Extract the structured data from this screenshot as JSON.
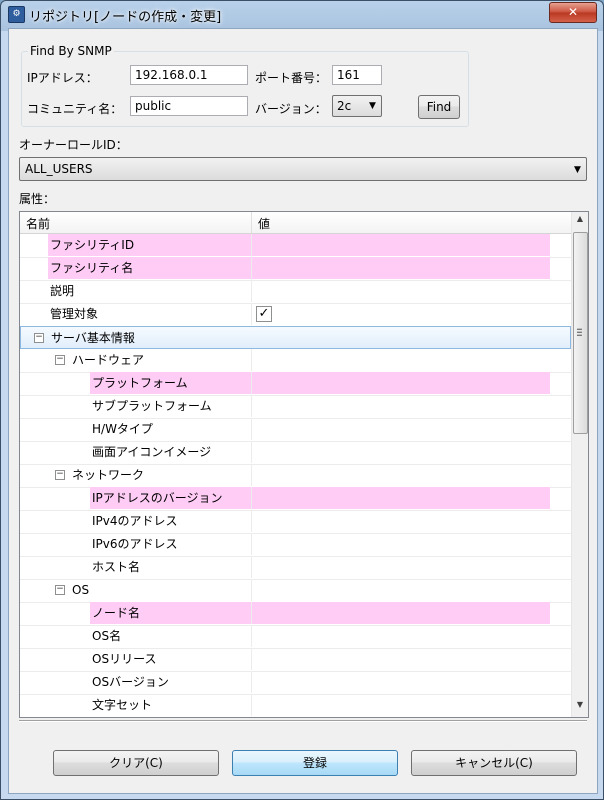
{
  "window": {
    "title": "リポジトリ[ノードの作成・変更]",
    "close_label": "✕"
  },
  "snmp": {
    "group_title": "Find By SNMP",
    "ip_label": "IPアドレス：",
    "ip_value": "192.168.0.1",
    "port_label": "ポート番号：",
    "port_value": "161",
    "community_label": "コミュニティ名：",
    "community_value": "public",
    "version_label": "バージョン：",
    "version_value": "2c",
    "find_label": "Find"
  },
  "owner": {
    "label": "オーナーロールID：",
    "value": "ALL_USERS"
  },
  "attributes": {
    "label": "属性：",
    "col_name": "名前",
    "col_value": "値",
    "rows": [
      {
        "name": "ファシリティID",
        "indent": 0,
        "required": true
      },
      {
        "name": "ファシリティ名",
        "indent": 0,
        "required": true
      },
      {
        "name": "説明",
        "indent": 0,
        "required": false
      },
      {
        "name": "管理対象",
        "indent": 0,
        "required": false,
        "checked": true
      },
      {
        "name": "サーバ基本情報",
        "indent": 0,
        "group": true,
        "expanded": true,
        "selected": true
      },
      {
        "name": "ハードウェア",
        "indent": 1,
        "group": true,
        "expanded": true
      },
      {
        "name": "プラットフォーム",
        "indent": 2,
        "required": true
      },
      {
        "name": "サブプラットフォーム",
        "indent": 2,
        "required": false
      },
      {
        "name": "H/Wタイプ",
        "indent": 2,
        "required": false
      },
      {
        "name": "画面アイコンイメージ",
        "indent": 2,
        "required": false
      },
      {
        "name": "ネットワーク",
        "indent": 1,
        "group": true,
        "expanded": true
      },
      {
        "name": "IPアドレスのバージョン",
        "indent": 2,
        "required": true
      },
      {
        "name": "IPv4のアドレス",
        "indent": 2,
        "required": false
      },
      {
        "name": "IPv6のアドレス",
        "indent": 2,
        "required": false
      },
      {
        "name": "ホスト名",
        "indent": 2,
        "required": false
      },
      {
        "name": "OS",
        "indent": 1,
        "group": true,
        "expanded": true
      },
      {
        "name": "ノード名",
        "indent": 2,
        "required": true
      },
      {
        "name": "OS名",
        "indent": 2,
        "required": false
      },
      {
        "name": "OSリリース",
        "indent": 2,
        "required": false
      },
      {
        "name": "OSバージョン",
        "indent": 2,
        "required": false
      },
      {
        "name": "文字セット",
        "indent": 2,
        "required": false
      }
    ]
  },
  "buttons": {
    "clear": "クリア(C)",
    "register": "登録",
    "cancel": "キャンセル(C)"
  },
  "colors": {
    "required_bg": "#ffccf5",
    "selected_bg": "#e1eefb"
  }
}
